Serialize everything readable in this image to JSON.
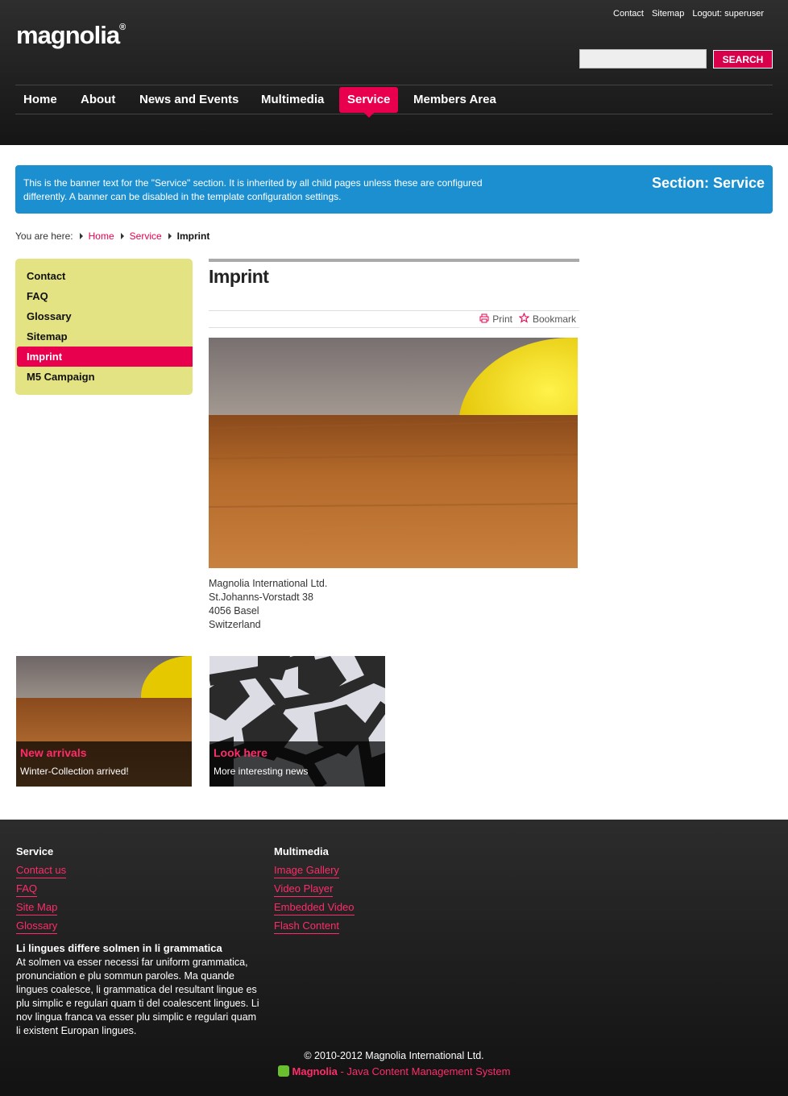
{
  "header": {
    "logo": "magnolia",
    "logo_mark": "®",
    "meta_nav": [
      "Contact",
      "Sitemap",
      "Logout: superuser"
    ],
    "search_button": "SEARCH",
    "search_placeholder": ""
  },
  "nav": [
    {
      "label": "Home"
    },
    {
      "label": "About"
    },
    {
      "label": "News and Events"
    },
    {
      "label": "Multimedia"
    },
    {
      "label": "Service"
    },
    {
      "label": "Members Area"
    }
  ],
  "banner": {
    "text": "This is the banner text for the \"Service\" section. It is inherited by all child pages unless these are configured differently. A banner can be disabled in the template configuration settings.",
    "section": "Section: Service"
  },
  "breadcrumb": {
    "prefix": "You are here:",
    "items": [
      "Home",
      "Service"
    ],
    "current": "Imprint"
  },
  "sidebar": [
    "Contact",
    "FAQ",
    "Glossary",
    "Sitemap",
    "Imprint",
    "M5 Campaign"
  ],
  "main": {
    "title": "Imprint",
    "print": "Print",
    "bookmark": "Bookmark",
    "address": [
      "Magnolia International Ltd.",
      "St.Johanns-Vorstadt 38",
      "4056 Basel",
      "Switzerland"
    ]
  },
  "teasers": [
    {
      "title": "New arrivals",
      "sub": "Winter-Collection arrived!"
    },
    {
      "title": "Look here",
      "sub": "More interesting news"
    }
  ],
  "footer": {
    "col1": {
      "head": "Service",
      "links": [
        "Contact us",
        "FAQ",
        "Site Map",
        "Glossary"
      ]
    },
    "col2": {
      "head": "Multimedia",
      "links": [
        "Image Gallery",
        "Video Player",
        "Embedded Video",
        "Flash Content"
      ]
    },
    "text_title": "Li lingues differe solmen in li grammatica",
    "text": "At solmen va esser necessi far uniform grammatica, pronunciation e plu sommun paroles. Ma quande lingues coalesce, li grammatica del resultant lingue es plu simplic e regulari quam ti del coalescent lingues. Li nov lingua franca va esser plu simplic e regulari quam li existent Europan lingues.",
    "copyright": "© 2010-2012 Magnolia International Ltd.",
    "powered_brand": "Magnolia",
    "powered_rest": " - Java Content Management System"
  },
  "colors": {
    "accent": "#e8004f",
    "banner": "#1b8fcf",
    "sidebar": "#e3e383"
  }
}
